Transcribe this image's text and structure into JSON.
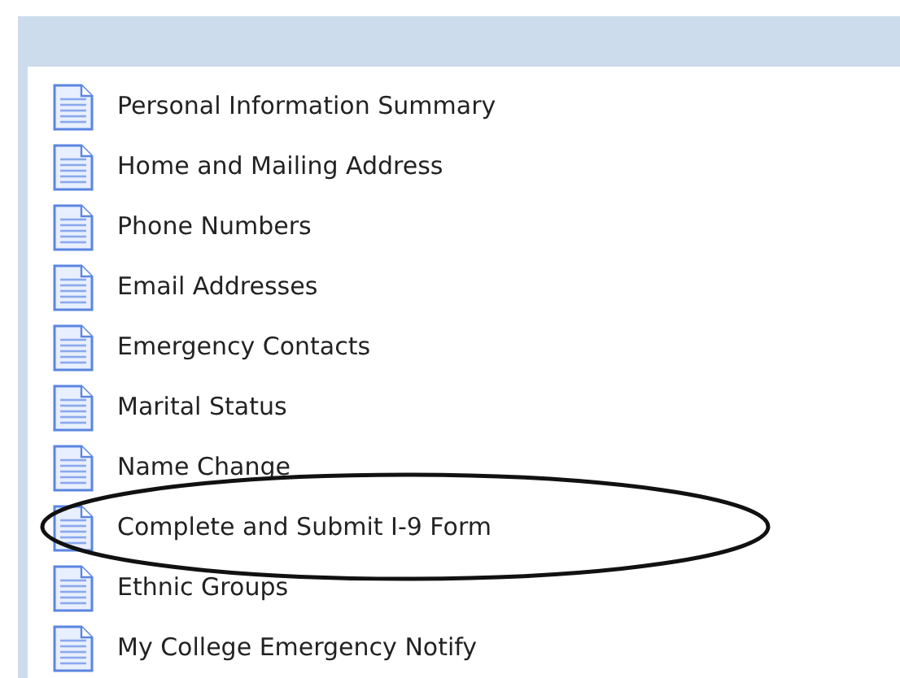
{
  "menu": {
    "items": [
      {
        "label": "Personal Information Summary",
        "circled": false
      },
      {
        "label": "Home and Mailing Address",
        "circled": false
      },
      {
        "label": "Phone Numbers",
        "circled": false
      },
      {
        "label": "Email Addresses",
        "circled": false
      },
      {
        "label": "Emergency Contacts",
        "circled": false
      },
      {
        "label": "Marital Status",
        "circled": false
      },
      {
        "label": "Name Change",
        "circled": false
      },
      {
        "label": "Complete and Submit I-9 Form",
        "circled": true
      },
      {
        "label": "Ethnic Groups",
        "circled": false
      },
      {
        "label": "My College Emergency Notify",
        "circled": false
      }
    ]
  }
}
